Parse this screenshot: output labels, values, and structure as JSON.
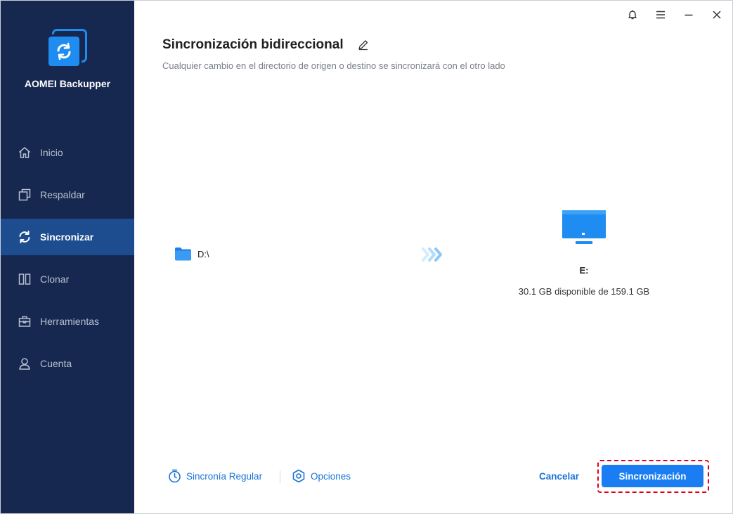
{
  "app": {
    "brand": "AOMEI Backupper"
  },
  "title_bar": {
    "icons": [
      "bell-icon",
      "menu-icon",
      "minimize-icon",
      "close-icon"
    ]
  },
  "sidebar": {
    "items": [
      {
        "label": "Inicio",
        "icon": "home-icon",
        "active": false
      },
      {
        "label": "Respaldar",
        "icon": "backup-icon",
        "active": false
      },
      {
        "label": "Sincronizar",
        "icon": "sync-icon",
        "active": true
      },
      {
        "label": "Clonar",
        "icon": "clone-icon",
        "active": false
      },
      {
        "label": "Herramientas",
        "icon": "toolbox-icon",
        "active": false
      },
      {
        "label": "Cuenta",
        "icon": "user-icon",
        "active": false
      }
    ]
  },
  "main": {
    "title": "Sincronización bidireccional",
    "subtitle": "Cualquier cambio en el directorio de origen o destino se sincronizará con el otro lado",
    "source": {
      "label": "D:\\",
      "icon": "folder-icon"
    },
    "destination": {
      "name": "E:",
      "space": "30.1 GB disponible de 159.1 GB",
      "icon": "monitor-icon"
    }
  },
  "footer": {
    "schedule_label": "Sincronía Regular",
    "options_label": "Opciones",
    "cancel_label": "Cancelar",
    "start_label": "Sincronización"
  },
  "colors": {
    "sidebar_bg": "#16284f",
    "sidebar_active": "#1d4d8f",
    "accent": "#1a7ef2",
    "highlight_border": "#e0001a"
  }
}
